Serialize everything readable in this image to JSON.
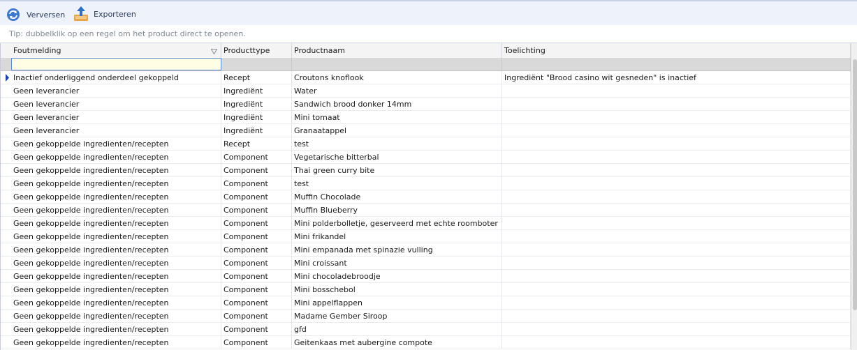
{
  "toolbar": {
    "refresh_label": "Verversen",
    "export_label": "Exporteren",
    "refresh_icon": "refresh-icon",
    "export_icon": "export-icon"
  },
  "tip": "Tip: dubbelklik op een regel om het product direct te openen.",
  "grid": {
    "columns": [
      "Foutmelding",
      "Producttype",
      "Productnaam",
      "Toelichting"
    ],
    "sorted_column_icon": "filter-sort-icon",
    "current_row_indicator": "row-pointer-icon",
    "rows": [
      [
        "Inactief onderliggend onderdeel gekoppeld",
        "Recept",
        "Croutons knoflook",
        "Ingrediënt \"Brood casino wit gesneden\" is inactief"
      ],
      [
        "Geen leverancier",
        "Ingrediënt",
        "Water",
        ""
      ],
      [
        "Geen leverancier",
        "Ingrediënt",
        "Sandwich brood donker 14mm",
        ""
      ],
      [
        "Geen leverancier",
        "Ingrediënt",
        "Mini tomaat",
        ""
      ],
      [
        "Geen leverancier",
        "Ingrediënt",
        "Granaatappel",
        ""
      ],
      [
        "Geen gekoppelde ingredienten/recepten",
        "Recept",
        "test",
        ""
      ],
      [
        "Geen gekoppelde ingredienten/recepten",
        "Component",
        "Vegetarische bitterbal",
        ""
      ],
      [
        "Geen gekoppelde ingredienten/recepten",
        "Component",
        "Thai green curry bite",
        ""
      ],
      [
        "Geen gekoppelde ingredienten/recepten",
        "Component",
        "test",
        ""
      ],
      [
        "Geen gekoppelde ingredienten/recepten",
        "Component",
        "Muffin Chocolade",
        ""
      ],
      [
        "Geen gekoppelde ingredienten/recepten",
        "Component",
        "Muffin Blueberry",
        ""
      ],
      [
        "Geen gekoppelde ingredienten/recepten",
        "Component",
        "Mini polderbolletje, geserveerd met echte roomboter",
        ""
      ],
      [
        "Geen gekoppelde ingredienten/recepten",
        "Component",
        "Mini frikandel",
        ""
      ],
      [
        "Geen gekoppelde ingredienten/recepten",
        "Component",
        "Mini empanada met spinazie vulling",
        ""
      ],
      [
        "Geen gekoppelde ingredienten/recepten",
        "Component",
        "Mini croissant",
        ""
      ],
      [
        "Geen gekoppelde ingredienten/recepten",
        "Component",
        "Mini chocoladebroodje",
        ""
      ],
      [
        "Geen gekoppelde ingredienten/recepten",
        "Component",
        "Mini bosschebol",
        ""
      ],
      [
        "Geen gekoppelde ingredienten/recepten",
        "Component",
        "Mini appelflappen",
        ""
      ],
      [
        "Geen gekoppelde ingredienten/recepten",
        "Component",
        "Madame Gember Siroop",
        ""
      ],
      [
        "Geen gekoppelde ingredienten/recepten",
        "Component",
        "gfd",
        ""
      ],
      [
        "Geen gekoppelde ingredienten/recepten",
        "Component",
        "Geitenkaas met aubergine compote",
        ""
      ]
    ]
  },
  "colors": {
    "toolbar_bg": "#eef2fb",
    "accent": "#2f6fc9",
    "row_pointer": "#1a3fb0"
  }
}
